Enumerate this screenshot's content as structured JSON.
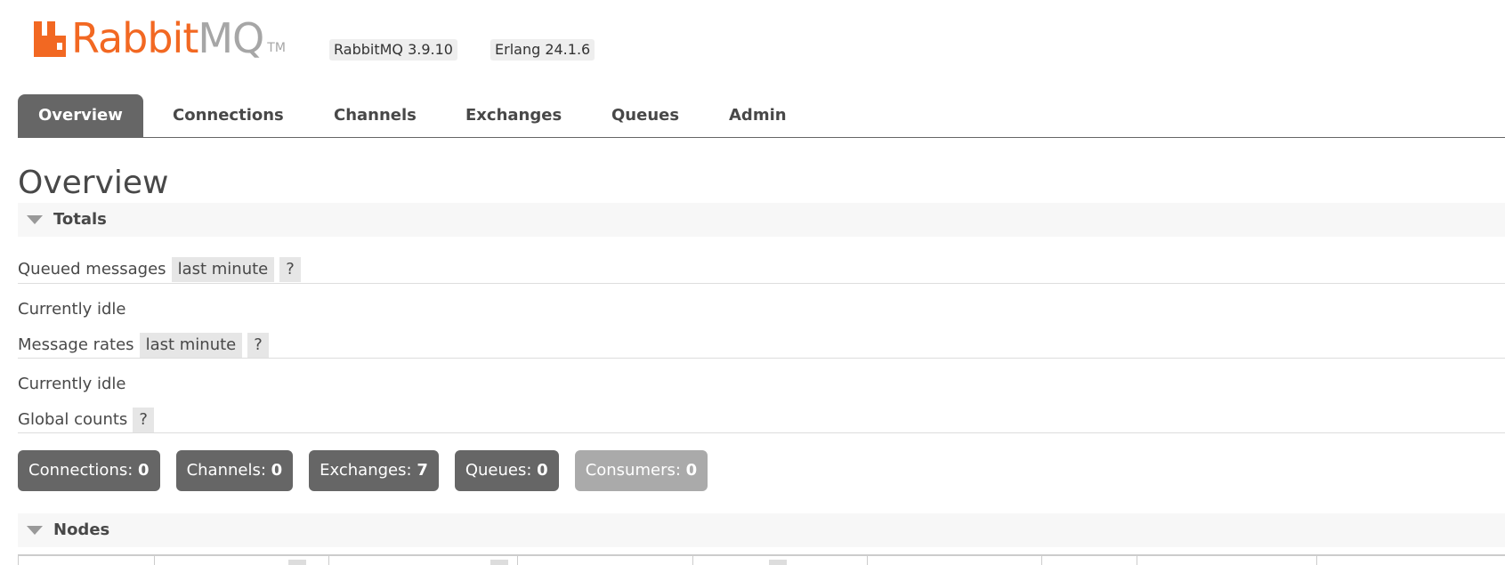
{
  "header": {
    "logo_rabbit": "Rabbit",
    "logo_mq": "MQ",
    "logo_tm": "TM",
    "rabbitmq_version": "RabbitMQ 3.9.10",
    "erlang_version": "Erlang 24.1.6",
    "brand_color": "#f26822"
  },
  "tabs": [
    {
      "label": "Overview",
      "active": true
    },
    {
      "label": "Connections",
      "active": false
    },
    {
      "label": "Channels",
      "active": false
    },
    {
      "label": "Exchanges",
      "active": false
    },
    {
      "label": "Queues",
      "active": false
    },
    {
      "label": "Admin",
      "active": false
    }
  ],
  "page_title": "Overview",
  "totals": {
    "title": "Totals",
    "queued_messages_label": "Queued messages",
    "queued_messages_range": "last minute",
    "queued_messages_status": "Currently idle",
    "message_rates_label": "Message rates",
    "message_rates_range": "last minute",
    "message_rates_status": "Currently idle",
    "global_counts_label": "Global counts",
    "help": "?",
    "counts": [
      {
        "label": "Connections:",
        "value": "0"
      },
      {
        "label": "Channels:",
        "value": "0"
      },
      {
        "label": "Exchanges:",
        "value": "7"
      },
      {
        "label": "Queues:",
        "value": "0"
      },
      {
        "label": "Consumers:",
        "value": "0"
      }
    ]
  },
  "nodes": {
    "title": "Nodes"
  }
}
